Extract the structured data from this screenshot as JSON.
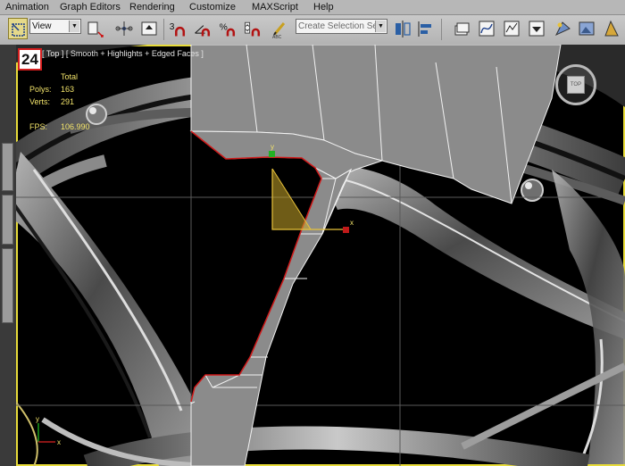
{
  "menu": {
    "items": [
      "Animation",
      "Graph Editors",
      "Rendering",
      "Customize",
      "MAXScript",
      "Help"
    ]
  },
  "toolbar": {
    "reference_coordinate_dropdown": "View",
    "selection_set_dropdown": "Create Selection Se",
    "snap_3d_label": "3",
    "tools": [
      "select-region-icon",
      "select-and-link-icon",
      "pivot-icon",
      "select-by-name-icon",
      "snaps-toggle-icon",
      "angle-snap-icon",
      "percent-snap-icon",
      "spinner-snap-icon",
      "edit-named-selections-icon",
      "mirror-icon",
      "align-icon",
      "layer-manager-icon",
      "curve-editor-icon",
      "schematic-view-icon",
      "material-editor-icon",
      "render-setup-icon",
      "render-frame-icon",
      "render-icon"
    ]
  },
  "viewport": {
    "badge": "24",
    "label": "[ Top ] [ Smooth + Highlights + Edged Faces ]",
    "stats": {
      "header": "Total",
      "polys_label": "Polys:",
      "polys_value": "163",
      "verts_label": "Verts:",
      "verts_value": "291",
      "fps_label": "FPS:",
      "fps_value": "106.990"
    },
    "viewcube_label": "TOP",
    "gizmo": {
      "x_label": "x",
      "y_label": "y"
    },
    "axis_tripod": {
      "x_label": "x",
      "y_label": "y"
    }
  },
  "colors": {
    "active_viewport_border": "#e8dc3a",
    "stats_text": "#f2e36a",
    "badge_border": "#d31d1d",
    "mesh_fill": "#8b8b8b",
    "selection_edge": "#d01818"
  }
}
